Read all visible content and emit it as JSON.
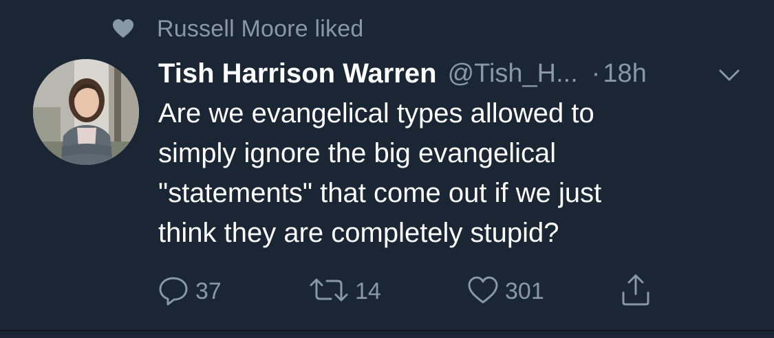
{
  "social_context": {
    "text": "Russell Moore liked",
    "icon": "heart-filled-icon"
  },
  "tweet": {
    "author_name": "Tish Harrison Warren",
    "author_handle": "@Tish_H...",
    "separator": "·",
    "time": "18h",
    "avatar_icon": "avatar-photo",
    "menu_icon": "chevron-down-icon",
    "body_lines": [
      "Are we evangelical types allowed to",
      "simply ignore the big evangelical",
      "\"statements\" that come out if we just",
      "think they are completely stupid?"
    ]
  },
  "actions": {
    "reply_count": "37",
    "retweet_count": "14",
    "like_count": "301",
    "icons": {
      "reply": "reply-icon",
      "retweet": "retweet-icon",
      "like": "heart-outline-icon",
      "share": "share-icon"
    }
  },
  "colors": {
    "background": "#1b2634",
    "primary_text": "#ffffff",
    "secondary_text": "#8899a6"
  }
}
